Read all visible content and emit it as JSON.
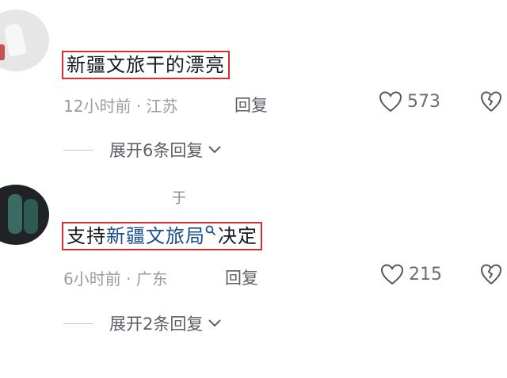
{
  "comments": [
    {
      "text": "新疆文旅干的漂亮",
      "time": "12小时前",
      "location": "江苏",
      "reply_label": "回复",
      "likes": "573",
      "expand_label": "展开6条回复"
    },
    {
      "text_before": "支持",
      "linked_text": "新疆文旅局",
      "text_after": "决定",
      "time": "6小时前",
      "location": "广东",
      "reply_label": "回复",
      "likes": "215",
      "expand_label": "展开2条回复"
    }
  ],
  "stray_char": "于",
  "colors": {
    "highlight_border": "#d8302f",
    "link": "#1a4d8f",
    "meta": "#9b9ca3"
  }
}
